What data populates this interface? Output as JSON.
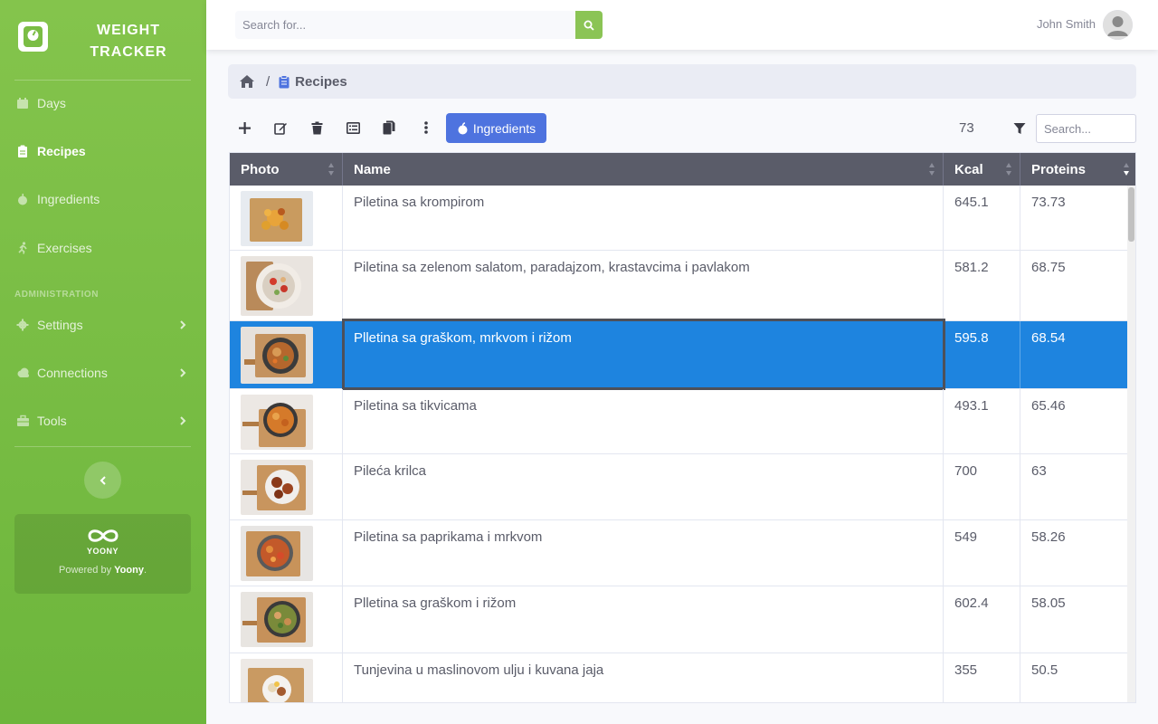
{
  "brand": {
    "title": "WEIGHT TRACKER"
  },
  "sidebar": {
    "items": [
      {
        "label": "Days",
        "icon": "calendar-icon",
        "active": false
      },
      {
        "label": "Recipes",
        "icon": "clipboard-icon",
        "active": true
      },
      {
        "label": "Ingredients",
        "icon": "apple-icon",
        "active": false
      },
      {
        "label": "Exercises",
        "icon": "running-icon",
        "active": false
      }
    ],
    "admin_heading": "ADMINISTRATION",
    "admin_items": [
      {
        "label": "Settings",
        "icon": "gear-icon"
      },
      {
        "label": "Connections",
        "icon": "cloud-icon"
      },
      {
        "label": "Tools",
        "icon": "toolbox-icon"
      }
    ],
    "powered": {
      "logo_text": "YOONY",
      "prefix": "Powered by ",
      "company": "Yoony",
      "suffix": "."
    }
  },
  "topbar": {
    "search_placeholder": "Search for...",
    "user_name": "John Smith"
  },
  "breadcrumb": {
    "separator": "/",
    "current": "Recipes"
  },
  "toolbar": {
    "ingredients_label": "Ingredients",
    "record_count": "73",
    "search_placeholder": "Search..."
  },
  "table": {
    "columns": [
      "Photo",
      "Name",
      "Kcal",
      "Proteins"
    ],
    "rows": [
      {
        "name": "Piletina sa krompirom",
        "kcal": "645.1",
        "proteins": "73.73",
        "selected": false
      },
      {
        "name": "Piletina sa zelenom salatom, paradajzom, krastavcima i pavlakom",
        "kcal": "581.2",
        "proteins": "68.75",
        "selected": false
      },
      {
        "name": "Plletina sa graškom, mrkvom i rižom",
        "kcal": "595.8",
        "proteins": "68.54",
        "selected": true
      },
      {
        "name": "Piletina sa tikvicama",
        "kcal": "493.1",
        "proteins": "65.46",
        "selected": false
      },
      {
        "name": "Pileća krilca",
        "kcal": "700",
        "proteins": "63",
        "selected": false
      },
      {
        "name": "Piletina sa paprikama i mrkvom",
        "kcal": "549",
        "proteins": "58.26",
        "selected": false
      },
      {
        "name": "Plletina sa graškom i rižom",
        "kcal": "602.4",
        "proteins": "58.05",
        "selected": false
      },
      {
        "name": "Tunjevina u maslinovom ulju i kuvana jaja",
        "kcal": "355",
        "proteins": "50.5",
        "selected": false
      }
    ]
  },
  "colors": {
    "sidebar_green": "#7bbd45",
    "primary_blue": "#4e73df",
    "selected_row": "#1e84df",
    "table_header": "#5a5c69"
  }
}
